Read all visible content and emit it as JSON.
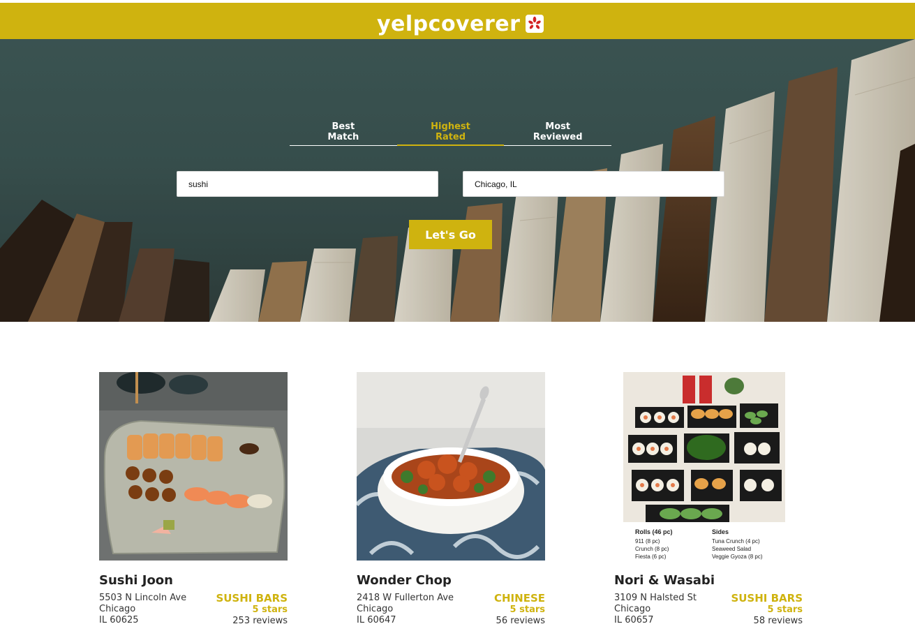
{
  "brand": {
    "name": "yelpcoverer",
    "accent": "#cfb30f"
  },
  "sort_tabs": [
    {
      "label_line1": "Best",
      "label_line2": "Match",
      "active": false
    },
    {
      "label_line1": "Highest",
      "label_line2": "Rated",
      "active": true
    },
    {
      "label_line1": "Most",
      "label_line2": "Reviewed",
      "active": false
    }
  ],
  "search": {
    "term_value": "sushi",
    "location_value": "Chicago, IL",
    "submit_label": "Let's Go"
  },
  "results": [
    {
      "name": "Sushi Joon",
      "address": "5503 N Lincoln Ave",
      "city": "Chicago",
      "state_zip": "IL 60625",
      "category": "SUSHI BARS",
      "rating": "5 stars",
      "reviews": "253 reviews"
    },
    {
      "name": "Wonder Chop",
      "address": "2418 W Fullerton Ave",
      "city": "Chicago",
      "state_zip": "IL 60647",
      "category": "CHINESE",
      "rating": "5 stars",
      "reviews": "56 reviews"
    },
    {
      "name": "Nori & Wasabi",
      "address": "3109 N Halsted St",
      "city": "Chicago",
      "state_zip": "IL 60657",
      "category": "SUSHI BARS",
      "rating": "5 stars",
      "reviews": "58 reviews"
    }
  ],
  "menu_photo": {
    "col1_heading": "Rolls (46 pc)",
    "col1_items": [
      "911 (8 pc)",
      "Crunch (8 pc)",
      "Fiesta (6 pc)"
    ],
    "col2_heading": "Sides",
    "col2_items": [
      "Tuna Crunch (4 pc)",
      "Seaweed Salad",
      "Veggie Gyoza (8 pc)"
    ]
  }
}
